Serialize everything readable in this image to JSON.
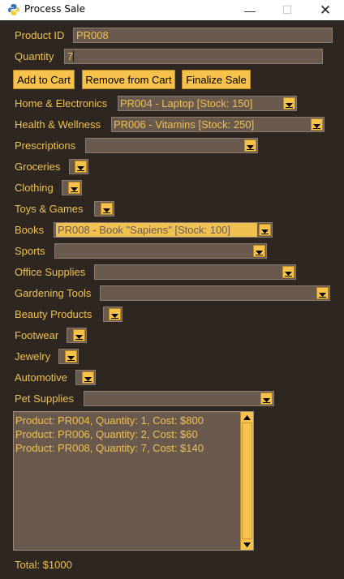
{
  "window": {
    "title": "Process Sale",
    "minimize": "—",
    "maximize": "☐",
    "close": "✕"
  },
  "form": {
    "product_id_label": "Product ID",
    "product_id_value": "PR008",
    "quantity_label": "Quantity",
    "quantity_value": "7"
  },
  "buttons": {
    "add": "Add to Cart",
    "remove": "Remove from Cart",
    "finalize": "Finalize Sale"
  },
  "categories": [
    {
      "label": "Home & Electronics",
      "value": "PR004 - Laptop [Stock: 150]"
    },
    {
      "label": "Health & Wellness",
      "value": "PR006 - Vitamins [Stock: 250]"
    },
    {
      "label": "Prescriptions",
      "value": ""
    },
    {
      "label": "Groceries",
      "value": ""
    },
    {
      "label": "Clothing",
      "value": ""
    },
    {
      "label": "Toys & Games",
      "value": ""
    },
    {
      "label": "Books",
      "value": "PR008 - Book \"Sapiens\" [Stock: 100]"
    },
    {
      "label": "Sports",
      "value": ""
    },
    {
      "label": "Office Supplies",
      "value": ""
    },
    {
      "label": "Gardening Tools",
      "value": ""
    },
    {
      "label": "Beauty Products",
      "value": ""
    },
    {
      "label": "Footwear",
      "value": ""
    },
    {
      "label": "Jewelry",
      "value": ""
    },
    {
      "label": "Automotive",
      "value": ""
    },
    {
      "label": "Pet Supplies",
      "value": ""
    }
  ],
  "cart": [
    "Product: PR004, Quantity: 1, Cost: $800",
    "Product: PR006, Quantity: 2, Cost: $60",
    "Product: PR008, Quantity: 7, Cost: $140"
  ],
  "total": "Total: $1000",
  "colors": {
    "background": "#2d2621",
    "field": "#6a5a4e",
    "accent": "#f6c24c",
    "text": "#f0c050"
  },
  "icons": {
    "app": "python-icon",
    "dropdown": "triangle-down-icon",
    "scroll_up": "triangle-up-icon",
    "scroll_down": "triangle-down-icon"
  }
}
